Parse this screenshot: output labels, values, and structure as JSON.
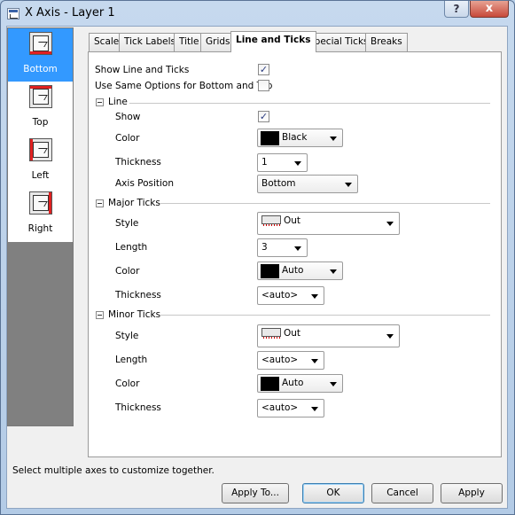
{
  "window": {
    "title": "X Axis - Layer 1",
    "help_label": "?",
    "close_label": "x"
  },
  "sidebar": {
    "items": [
      {
        "label": "Bottom",
        "selected": true,
        "icon": "axis-bottom-icon"
      },
      {
        "label": "Top",
        "selected": false,
        "icon": "axis-top-icon"
      },
      {
        "label": "Left",
        "selected": false,
        "icon": "axis-left-icon"
      },
      {
        "label": "Right",
        "selected": false,
        "icon": "axis-right-icon"
      }
    ]
  },
  "tabs": [
    "Scale",
    "Tick Labels",
    "Title",
    "Grids",
    "Line and Ticks",
    "Special Ticks",
    "Breaks"
  ],
  "active_tab": "Line and Ticks",
  "options": {
    "show_line_and_ticks": {
      "label": "Show Line and Ticks",
      "checked": true
    },
    "use_same_options": {
      "label": "Use Same Options for Bottom and Top",
      "checked": false
    }
  },
  "line": {
    "heading": "Line",
    "show": {
      "label": "Show",
      "checked": true
    },
    "color": {
      "label": "Color",
      "value": "Black",
      "swatch": "#000000"
    },
    "thickness": {
      "label": "Thickness",
      "value": "1"
    },
    "axis_position": {
      "label": "Axis Position",
      "value": "Bottom"
    }
  },
  "major_ticks": {
    "heading": "Major Ticks",
    "style": {
      "label": "Style",
      "value": "Out"
    },
    "length": {
      "label": "Length",
      "value": "3"
    },
    "color": {
      "label": "Color",
      "value": "Auto",
      "swatch": "#000000"
    },
    "thickness": {
      "label": "Thickness",
      "value": "<auto>"
    }
  },
  "minor_ticks": {
    "heading": "Minor Ticks",
    "style": {
      "label": "Style",
      "value": "Out"
    },
    "length": {
      "label": "Length",
      "value": "<auto>"
    },
    "color": {
      "label": "Color",
      "value": "Auto",
      "swatch": "#000000"
    },
    "thickness": {
      "label": "Thickness",
      "value": "<auto>"
    }
  },
  "status": "Select multiple axes to customize together.",
  "buttons": {
    "apply_to": "Apply To...",
    "ok": "OK",
    "cancel": "Cancel",
    "apply": "Apply"
  },
  "colors": {
    "selection": "#3399ff",
    "title_bar": "#b9d1ea"
  }
}
